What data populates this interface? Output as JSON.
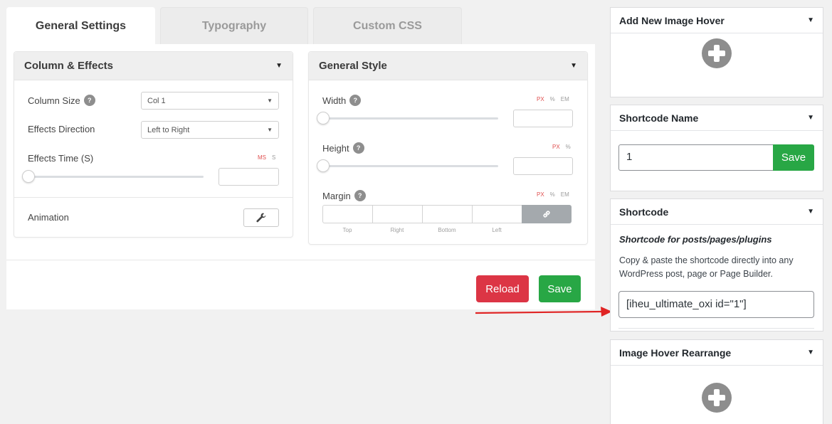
{
  "tabs": [
    {
      "label": "General Settings",
      "active": true
    },
    {
      "label": "Typography",
      "active": false
    },
    {
      "label": "Custom CSS",
      "active": false
    }
  ],
  "column_effects": {
    "title": "Column & Effects",
    "column_size": {
      "label": "Column Size",
      "value": "Col 1"
    },
    "effects_direction": {
      "label": "Effects Direction",
      "value": "Left to Right"
    },
    "effects_time": {
      "label": "Effects Time (S)",
      "units": [
        "MS",
        "S"
      ],
      "active_unit": "MS",
      "value": ""
    },
    "animation": {
      "label": "Animation"
    }
  },
  "general_style": {
    "title": "General Style",
    "width": {
      "label": "Width",
      "units": [
        "PX",
        "%",
        "EM"
      ],
      "active_unit": "PX",
      "value": ""
    },
    "height": {
      "label": "Height",
      "units": [
        "PX",
        "%"
      ],
      "active_unit": "PX",
      "value": ""
    },
    "margin": {
      "label": "Margin",
      "units": [
        "PX",
        "%",
        "EM"
      ],
      "active_unit": "PX",
      "sides": [
        "Top",
        "Right",
        "Bottom",
        "Left"
      ]
    }
  },
  "actions": {
    "reload_label": "Reload",
    "save_label": "Save"
  },
  "sidebar": {
    "add_new": {
      "title": "Add New Image Hover"
    },
    "shortcode_name": {
      "title": "Shortcode Name",
      "value": "1",
      "save_label": "Save"
    },
    "shortcode": {
      "title": "Shortcode",
      "subtitle": "Shortcode for posts/pages/plugins",
      "description": "Copy & paste the shortcode directly into any WordPress post, page or Page Builder.",
      "value": "[iheu_ultimate_oxi id=\"1\"]"
    },
    "rearrange": {
      "title": "Image Hover Rearrange"
    }
  },
  "colors": {
    "reload": "#dc3545",
    "save": "#28a745",
    "annotation_arrow": "#e02424",
    "unit_active": "#e05050"
  }
}
